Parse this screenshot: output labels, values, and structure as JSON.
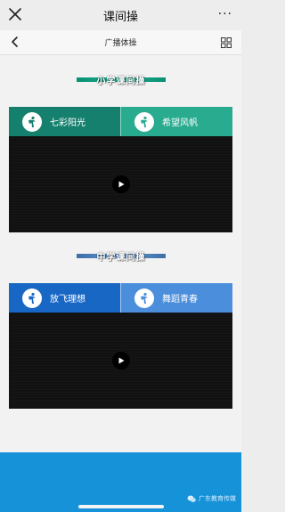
{
  "window": {
    "title": "课间操",
    "more_glyph": "···"
  },
  "navbar": {
    "title": "广播体操"
  },
  "sections": [
    {
      "banner": "小学课间操",
      "tabs": [
        {
          "label": "七彩阳光",
          "active": true
        },
        {
          "label": "希望风帆",
          "active": false
        }
      ]
    },
    {
      "banner": "中学课间操",
      "tabs": [
        {
          "label": "放飞理想",
          "active": true
        },
        {
          "label": "舞蹈青春",
          "active": false
        }
      ]
    }
  ],
  "footer": {
    "watermark": "广东教育传媒"
  },
  "colors": {
    "primary_green": "#14806d",
    "secondary_green": "#29ab8f",
    "primary_blue": "#1967c5",
    "secondary_blue": "#4b8edc",
    "footer_blue": "#1592d8"
  },
  "icons": {
    "close": "close-icon",
    "more": "more-icon",
    "back": "chevron-left-icon",
    "grid": "grid-icon",
    "logo": "dancer-logo-icon",
    "play": "play-icon",
    "wechat": "wechat-icon"
  }
}
